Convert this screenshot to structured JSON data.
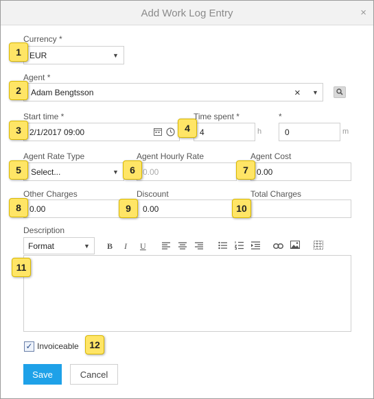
{
  "dialog": {
    "title": "Add Work Log Entry",
    "close_glyph": "×"
  },
  "currency": {
    "label": "Currency *",
    "value": "EUR"
  },
  "agent": {
    "label": "Agent *",
    "value": "Adam Bengtsson",
    "clear_glyph": "×"
  },
  "start_time": {
    "label": "Start time *",
    "value": "2/1/2017 09:00"
  },
  "time_spent": {
    "label": "Time spent *",
    "hours_value": "4",
    "hours_unit": "h",
    "minutes_label": "*",
    "minutes_value": "0",
    "minutes_unit": "m"
  },
  "agent_rate_type": {
    "label": "Agent Rate Type",
    "value": "Select..."
  },
  "agent_hourly_rate": {
    "label": "Agent Hourly Rate",
    "value": "0.00"
  },
  "agent_cost": {
    "label": "Agent Cost",
    "value": "0.00"
  },
  "other_charges": {
    "label": "Other Charges",
    "value": "0.00"
  },
  "discount": {
    "label": "Discount",
    "value": "0.00"
  },
  "total_charges": {
    "label": "Total Charges",
    "value": ""
  },
  "description": {
    "label": "Description",
    "format_label": "Format",
    "toolbar": {
      "bold": "B",
      "italic": "I",
      "underline": "U"
    }
  },
  "invoiceable": {
    "label": "Invoiceable",
    "checked_glyph": "✓"
  },
  "buttons": {
    "save": "Save",
    "cancel": "Cancel"
  },
  "callouts": [
    "1",
    "2",
    "3",
    "4",
    "5",
    "6",
    "7",
    "8",
    "9",
    "10",
    "11",
    "12"
  ],
  "colors": {
    "accent": "#1ea1e8",
    "callout": "#ffe566"
  }
}
